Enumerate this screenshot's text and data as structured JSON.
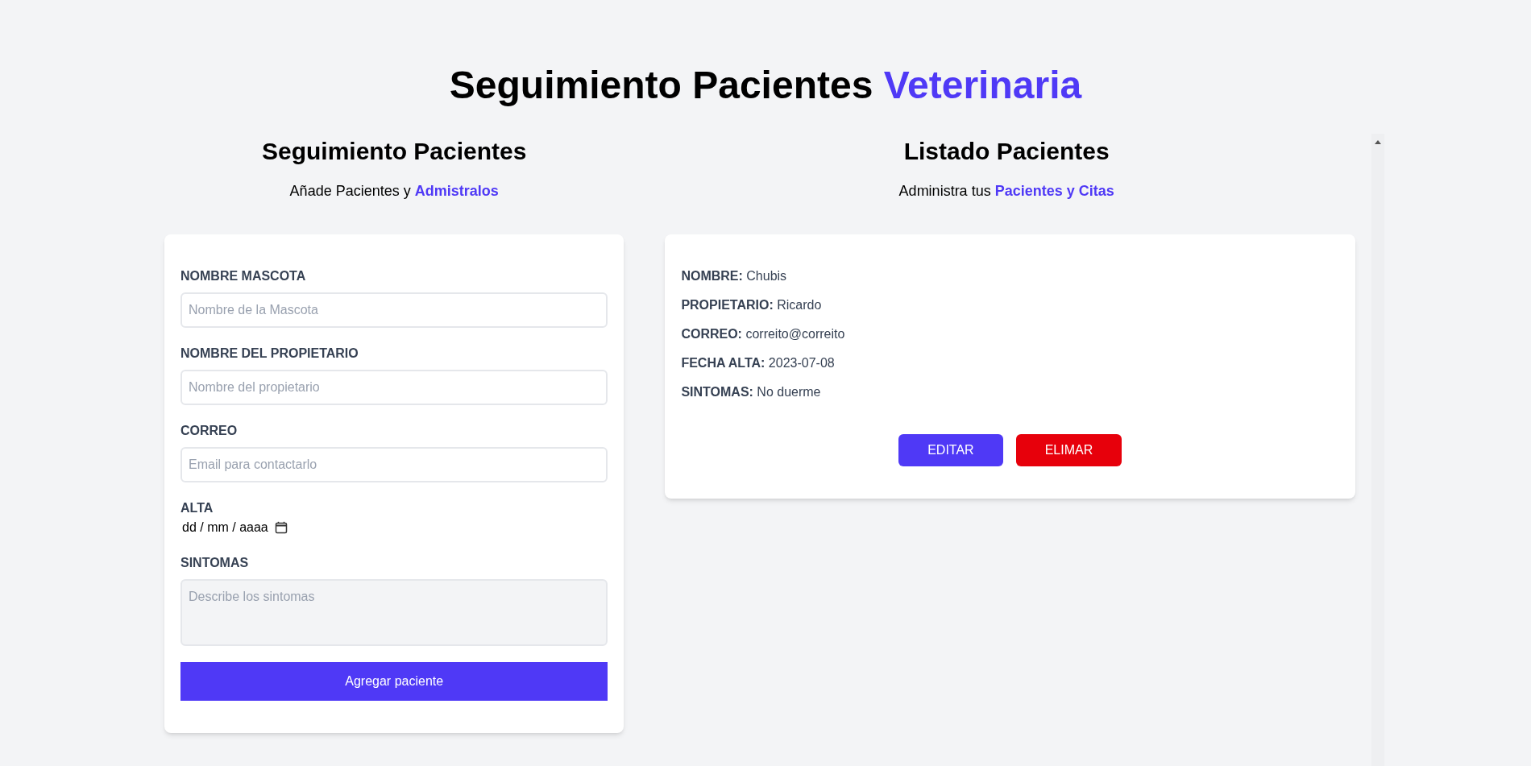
{
  "title": {
    "text": "Seguimiento Pacientes",
    "highlight": "Veterinaria"
  },
  "form_section": {
    "heading": "Seguimiento Pacientes",
    "subtitle": {
      "text": "Añade Pacientes y",
      "highlight": "Admistralos"
    },
    "fields": [
      {
        "kind": "text",
        "label": "NOMBRE MASCOTA",
        "placeholder": "Nombre de la Mascota"
      },
      {
        "kind": "text",
        "label": "NOMBRE DEL PROPIETARIO",
        "placeholder": "Nombre del propietario"
      },
      {
        "kind": "text",
        "label": "CORREO",
        "placeholder": "Email para contactarlo"
      },
      {
        "kind": "date",
        "label": "ALTA",
        "placeholder": "dd / mm / aaaa"
      },
      {
        "kind": "textarea",
        "label": "SINTOMAS",
        "placeholder": "Describe los sintomas"
      }
    ],
    "submit_button": "Agregar paciente"
  },
  "list_section": {
    "heading": "Listado Pacientes",
    "subtitle": {
      "text": "Administra tus",
      "highlight": "Pacientes y Citas"
    },
    "patients": [
      {
        "fields": [
          {
            "label": "NOMBRE:",
            "value": "Chubis"
          },
          {
            "label": "PROPIETARIO:",
            "value": "Ricardo"
          },
          {
            "label": "CORREO:",
            "value": "correito@correito"
          },
          {
            "label": "FECHA ALTA:",
            "value": "2023-07-08"
          },
          {
            "label": "SINTOMAS:",
            "value": "No duerme"
          }
        ],
        "buttons": [
          {
            "kind": "edit",
            "label": "EDITAR"
          },
          {
            "kind": "delete",
            "label": "ELIMAR"
          }
        ]
      }
    ]
  }
}
